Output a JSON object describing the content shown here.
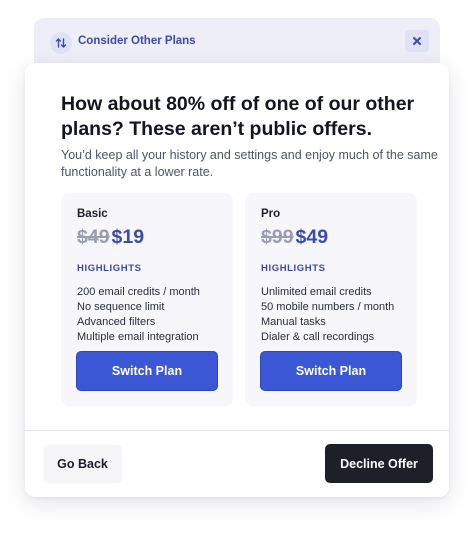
{
  "tab": {
    "title": "Consider Other Plans",
    "icon": "swap-arrows-icon",
    "close_icon": "close-x-icon"
  },
  "offer": {
    "headline": "How about 80% off of one of our other plans? These aren’t public offers.",
    "subtext": "You’d keep all your history and settings and enjoy much of the same functionality at a lower rate."
  },
  "plans": [
    {
      "name": "Basic",
      "old_price": "$49",
      "new_price": "$19",
      "highlights_label": "HIGHLIGHTS",
      "features": [
        "200 email credits / month",
        "No sequence limit",
        "Advanced filters",
        "Multiple email integration"
      ],
      "button_label": "Switch Plan"
    },
    {
      "name": "Pro",
      "old_price": "$99",
      "new_price": "$49",
      "highlights_label": "HIGHLIGHTS",
      "features": [
        "Unlimited email credits",
        "50 mobile numbers / month",
        "Manual tasks",
        "Dialer & call recordings"
      ],
      "button_label": "Switch Plan"
    }
  ],
  "footer": {
    "back_label": "Go Back",
    "decline_label": "Decline Offer"
  },
  "colors": {
    "accent": "#3b4ba8",
    "button_blue": "#3b57d6",
    "dark_button": "#1d2027",
    "tab_bg": "#eeeef8",
    "plan_bg": "#f6f6fb"
  }
}
